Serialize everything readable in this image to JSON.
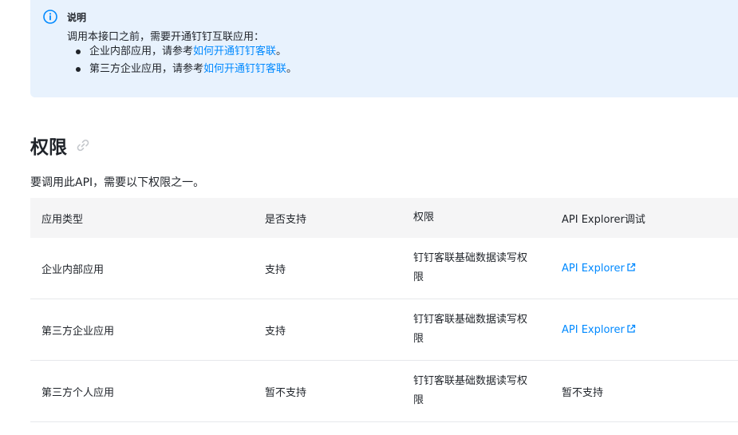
{
  "notice": {
    "title": "说明",
    "text": "调用本接口之前，需要开通钉钉互联应用：",
    "items": [
      {
        "prefix": "企业内部应用，请参考",
        "link": "如何开通钉钉客联",
        "suffix": "。"
      },
      {
        "prefix": "第三方企业应用，请参考",
        "link": "如何开通钉钉客联",
        "suffix": "。"
      }
    ]
  },
  "section": {
    "title": "权限",
    "description": "要调用此API，需要以下权限之一。"
  },
  "table": {
    "headers": [
      "应用类型",
      "是否支持",
      "权限",
      "API Explorer调试"
    ],
    "rows": [
      {
        "type": "企业内部应用",
        "support": "支持",
        "permission": "钉钉客联基础数据读写权限",
        "explorer": "API Explorer",
        "explorer_is_link": true
      },
      {
        "type": "第三方企业应用",
        "support": "支持",
        "permission": "钉钉客联基础数据读写权限",
        "explorer": "API Explorer",
        "explorer_is_link": true
      },
      {
        "type": "第三方个人应用",
        "support": "暂不支持",
        "permission": "钉钉客联基础数据读写权限",
        "explorer": "暂不支持",
        "explorer_is_link": false
      }
    ]
  },
  "colors": {
    "accent": "#0089ff",
    "notice_bg": "#e8f2fd",
    "header_bg": "#f5f5f6"
  }
}
